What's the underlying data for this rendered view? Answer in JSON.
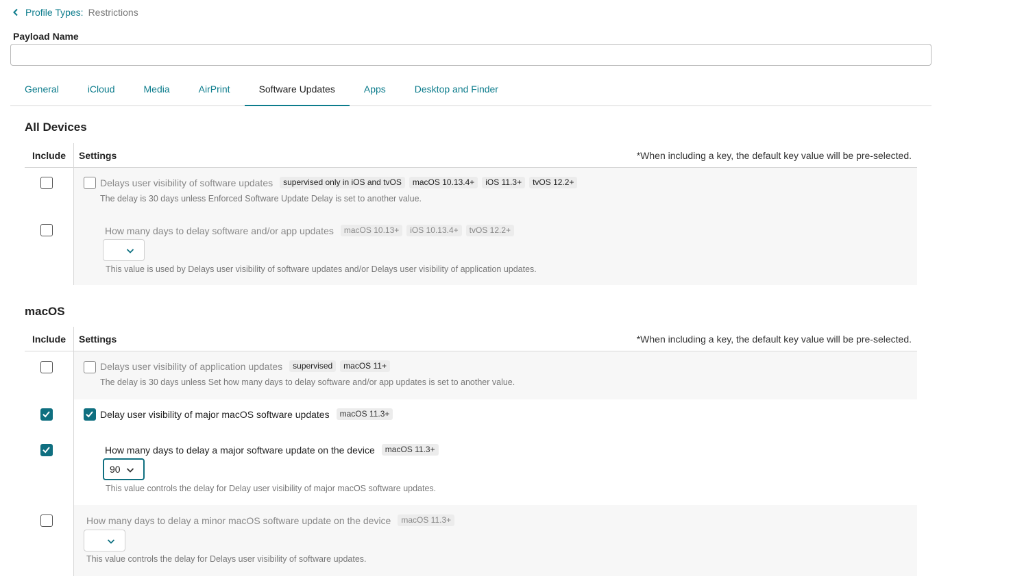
{
  "breadcrumb": {
    "link": "Profile Types:",
    "current": "Restrictions"
  },
  "payload": {
    "label": "Payload Name",
    "value": "",
    "placeholder": ""
  },
  "tabs": [
    {
      "label": "General"
    },
    {
      "label": "iCloud"
    },
    {
      "label": "Media"
    },
    {
      "label": "AirPrint"
    },
    {
      "label": "Software Updates",
      "active": true
    },
    {
      "label": "Apps"
    },
    {
      "label": "Desktop and Finder"
    }
  ],
  "table_header": {
    "include": "Include",
    "settings": "Settings",
    "note": "*When including a key, the default key value will be pre-selected."
  },
  "all_devices": {
    "title": "All Devices",
    "rows": [
      {
        "label": "Delays user visibility of software updates",
        "badges": [
          "supervised only in iOS and tvOS",
          "macOS 10.13.4+",
          "iOS 11.3+",
          "tvOS 12.2+"
        ],
        "helper": "The delay is 30 days unless Enforced Software Update Delay is set to another value.",
        "include_checked": false,
        "setting_checked": false
      },
      {
        "label": "How many days to delay software and/or app updates",
        "badges": [
          "macOS 10.13+",
          "iOS 10.13.4+",
          "tvOS 12.2+"
        ],
        "select_value": "",
        "helper": "This value is used by Delays user visibility of software updates and/or Delays user visibility of application updates.",
        "include_checked": false
      }
    ]
  },
  "macos": {
    "title": "macOS",
    "rows": [
      {
        "label": "Delays user visibility of application updates",
        "badges": [
          "supervised",
          "macOS 11+"
        ],
        "helper": "The delay is 30 days unless Set how many days to delay software and/or app updates is set to another value.",
        "include_checked": false,
        "setting_checked": false
      },
      {
        "label": "Delay user visibility of major macOS software updates",
        "badges": [
          "macOS 11.3+"
        ],
        "include_checked": true,
        "setting_checked": true
      },
      {
        "label": "How many days to delay a major software update on the device",
        "badges": [
          "macOS 11.3+"
        ],
        "select_value": "90",
        "helper": "This value controls the delay for Delay user visibility of major macOS software updates.",
        "include_checked": true
      },
      {
        "label": "How many days to delay a minor macOS software update on the device",
        "badges": [
          "macOS 11.3+"
        ],
        "select_value": "",
        "helper": "This value controls the delay for Delays user visibility of software updates.",
        "include_checked": false
      }
    ]
  },
  "colors": {
    "accent": "#0c7c8c",
    "checkbox_checked": "#0f6f80",
    "row_shade": "#f7f7f7"
  },
  "icons": {
    "back": "chevron-left-icon",
    "select": "chevron-down-icon",
    "check": "checkmark-icon"
  }
}
